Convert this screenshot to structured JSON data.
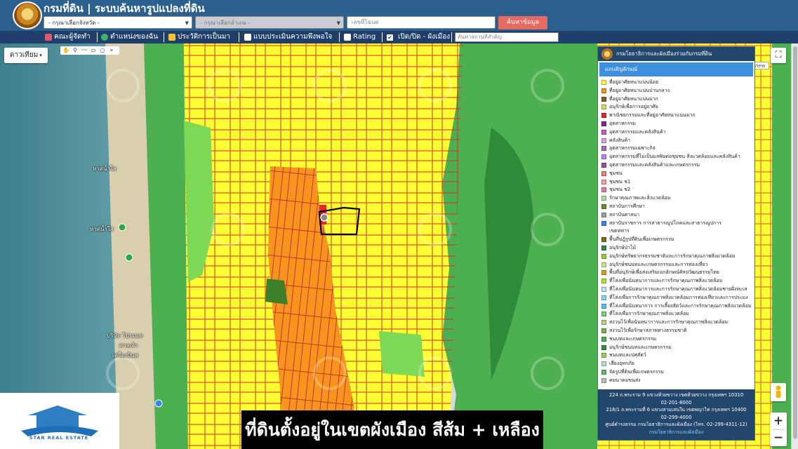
{
  "header": {
    "title": "กรมที่ดิน | ระบบค้นหารูปแปลงที่ดิน",
    "province_select": "- กรุณาเลือกจังหวัด -",
    "district_select": "- กรุณาเลือกอำเภอ -",
    "deed_placeholder": "เลขที่โฉนด",
    "search_button": "ค้นหาข้อมูล"
  },
  "navbar": {
    "items": [
      "คณะผู้จัดทำ",
      "ตำแหน่งของฉัน",
      "ประวัติการเป็นมา",
      "แบบประเมินความพึงพอใจ",
      "Rating",
      "เปิด/ปิด - ผังเมือง"
    ],
    "place_placeholder": "ค้นหาสถานที่สำคัญ"
  },
  "map": {
    "basemap_label": "ดาวเทียม",
    "view_tag": "View",
    "labels": [
      "หาดน้ำใส",
      "หาดน้ำใส",
      "บริษัท โปรมอท",
      "ศาลเจ้า",
      "เครื่องบินพ"
    ]
  },
  "legend": {
    "org": "กรมโยธาธิการและผังเมืองร่วมกับกรมที่ดิน",
    "tab": "แถบสัญลักษณ์",
    "items": [
      {
        "label": "ที่อยู่อาศัยหนาแน่นน้อย",
        "color": "#ffff33"
      },
      {
        "label": "ที่อยู่อาศัยหนาแน่นปานกลาง",
        "color": "#f7941d"
      },
      {
        "label": "ที่อยู่อาศัยหนาแน่นมาก",
        "color": "#8b5a2b"
      },
      {
        "label": "อนุรักษ์เพื่อการอยู่อาศัย",
        "color": "#d9d95c"
      },
      {
        "label": "พาณิชยกรรมและที่อยู่อาศัยหนาแน่นมาก",
        "color": "#e8232a"
      },
      {
        "label": "อุตสาหกรรม",
        "color": "#8b1fa0"
      },
      {
        "label": "อุตสาหกรรมและคลังสินค้า",
        "color": "#c95cc9"
      },
      {
        "label": "คลังสินค้า",
        "color": "#e0a3e0"
      },
      {
        "label": "อุตสาหกรรมเฉพาะกิจ",
        "color": "#a86bb8"
      },
      {
        "label": "อุตสาหกรรมที่ไม่เป็นมลพิษต่อชุมชน สิ่งแวดล้อมและคลังสินค้า",
        "color": "#b388ff"
      },
      {
        "label": "อุตสาหกรรมและคลังสินค้าและเกษตรกรรม",
        "color": "#9c4f9c"
      },
      {
        "label": "ชุมชน",
        "color": "#f08080"
      },
      {
        "label": "ชุมชน ช1",
        "color": "#f4a0a0"
      },
      {
        "label": "ชุมชน ช2",
        "color": "#e77b9a"
      },
      {
        "label": "รักษาคุณภาพและสิ่งแวดล้อม",
        "color": "#a6e3a6"
      },
      {
        "label": "สถาบันการศึกษา",
        "color": "#6b8e23"
      },
      {
        "label": "สถาบันศาสนา",
        "color": "#9e9e9e"
      },
      {
        "label": "สถาบันราชการ การสาธารณูปโภคและสาธารณูปการ",
        "color": "#3b82f6"
      },
      {
        "label": "เขตทหาร",
        "color": ""
      },
      {
        "label": "พื้นที่ปฏิรูปที่ดินเพื่อเกษตรกรรม",
        "color": "#8b6914"
      },
      {
        "label": "อนุรักษ์ป่าไม้",
        "color": "#2e8b57"
      },
      {
        "label": "อนุรักษ์ทรัพยากรธรรมชาติและการรักษาคุณภาพสิ่งแวดล้อม",
        "color": "#9acd32"
      },
      {
        "label": "อนุรักษ์ชนบทและเกษตรกรรมและการท่องเที่ยว",
        "color": "#c8e68c"
      },
      {
        "label": "พื้นที่อนุรักษ์เพื่อส่งเสริมเอกลักษณ์ศิลปวัฒนธรรมไทย",
        "color": "#d4a017"
      },
      {
        "label": "ที่โล่งเพื่อนันทนาการและการรักษาคุณภาพสิ่งแวดล้อม",
        "color": "#b5e61d"
      },
      {
        "label": "ที่โล่งเพื่อนันทนาการและการรักษาคุณภาพสิ่งแวดล้อมชายฝั่งทะเล",
        "color": "#b3e5fc"
      },
      {
        "label": "ที่โล่งเพื่อการรักษาคุณภาพสิ่งแวดล้อมการท่องเที่ยวและการประมง",
        "color": "#81d4fa"
      },
      {
        "label": "ที่โล่งเพื่อนันทนาการ การเลี้ยงสัตว์และการรักษาคุณภาพสิ่งแวดล้อม",
        "color": "#4fc3f7"
      },
      {
        "label": "ที่โล่งเพื่อการรักษาคุณภาพสิ่งแวดล้อม",
        "color": "#76d275"
      },
      {
        "label": "สงวนไว้เพื่อนันทนาการและการรักษาคุณภาพสิ่งแวดล้อม",
        "color": "#aed581"
      },
      {
        "label": "สงวนไว้เพื่อรักษาสภาพทางธรรมชาติ",
        "color": "#7cb342"
      },
      {
        "label": "ชนบทและเกษตรกรรม",
        "color": "#4caf50"
      },
      {
        "label": "อนุรักษ์ชนบทและเกษตรกรรม",
        "color": "#388e3c"
      },
      {
        "label": "ชนบทและปศุสัตว์",
        "color": "#9ccc65"
      },
      {
        "label": "เสี่ยงอุทกภัย",
        "color": "#b2dfdb"
      },
      {
        "label": "จัดรูปที่ดินเพื่อเกษตรกรรม",
        "color": "#66bb6a"
      },
      {
        "label": "คมนาคมขนส่ง",
        "color": "#bdbdbd"
      }
    ],
    "footer": [
      "224 ถ.พระราม 9 แขวงห้วยขวาง เขตห้วยขวาง กรุงเทพฯ 10310",
      "02-201-8000",
      "218/1 ถ.พระรามที่ 6 แขวงสามเสนใน เขตพญาไท กรุงเทพฯ 10400",
      "02-299-4000",
      "ศูนย์ดำรงธรรม กรมโยธาธิการและผังเมือง (โทร. 02-299-4311-12)",
      "กรมโยธาธิการและผังเมือง"
    ]
  },
  "overlay": {
    "brand": "STAR REAL ESTATE",
    "caption": "ที่ดินตั้งอยู่ในเขตผังเมือง สีส้ม + เหลือง"
  },
  "colors": {
    "header_bg": "#2b5f8e",
    "navbar_bg": "#1f3f6a",
    "zone_yellow": "#ffff33",
    "zone_orange": "#f7941d",
    "zone_green": "#4caf50",
    "road_red": "#d2332b"
  }
}
